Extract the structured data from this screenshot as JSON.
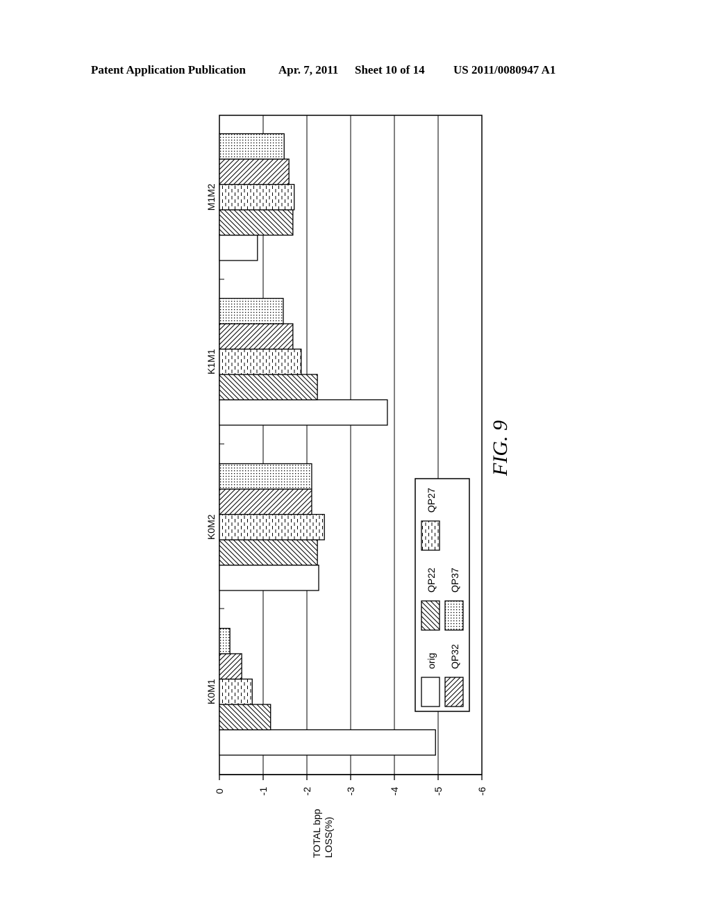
{
  "header": {
    "publication": "Patent Application Publication",
    "date": "Apr. 7, 2011",
    "sheet": "Sheet 10 of 14",
    "number": "US 2011/0080947 A1"
  },
  "figure_label": "FIG. 9",
  "chart_data": {
    "type": "bar",
    "orientation": "horizontal (rotated page; value axis along page width)",
    "title": "",
    "xlabel": "",
    "ylabel": "TOTAL bpp LOSS(%)",
    "ylabel_lines": [
      "TOTAL bpp",
      "LOSS(%)"
    ],
    "ylim": [
      -6,
      0
    ],
    "ticks": [
      0,
      -1,
      -2,
      -3,
      -4,
      -5,
      -6
    ],
    "tick_labels": [
      "0",
      "-1",
      "-2",
      "-3",
      "-4",
      "-5",
      "-6"
    ],
    "grid": true,
    "categories": [
      "K0M1",
      "K0M2",
      "K1M1",
      "M1M2"
    ],
    "series": [
      {
        "name": "orig",
        "pattern": "none",
        "values": [
          -4.94,
          -2.27,
          -3.84,
          -0.87
        ]
      },
      {
        "name": "QP22",
        "pattern": "backslash-hatch",
        "values": [
          -1.17,
          -2.24,
          -2.24,
          -1.68
        ]
      },
      {
        "name": "QP27",
        "pattern": "dashes",
        "values": [
          -0.75,
          -2.4,
          -1.87,
          -1.71
        ]
      },
      {
        "name": "QP32",
        "pattern": "slash-hatch",
        "values": [
          -0.51,
          -2.11,
          -1.68,
          -1.59
        ]
      },
      {
        "name": "QP37",
        "pattern": "dots",
        "values": [
          -0.24,
          -2.11,
          -1.46,
          -1.48
        ]
      }
    ],
    "legend": {
      "placement": "inside, lower-right region of plot",
      "entries": [
        "orig",
        "QP22",
        "QP27",
        "QP32",
        "QP37"
      ]
    }
  }
}
